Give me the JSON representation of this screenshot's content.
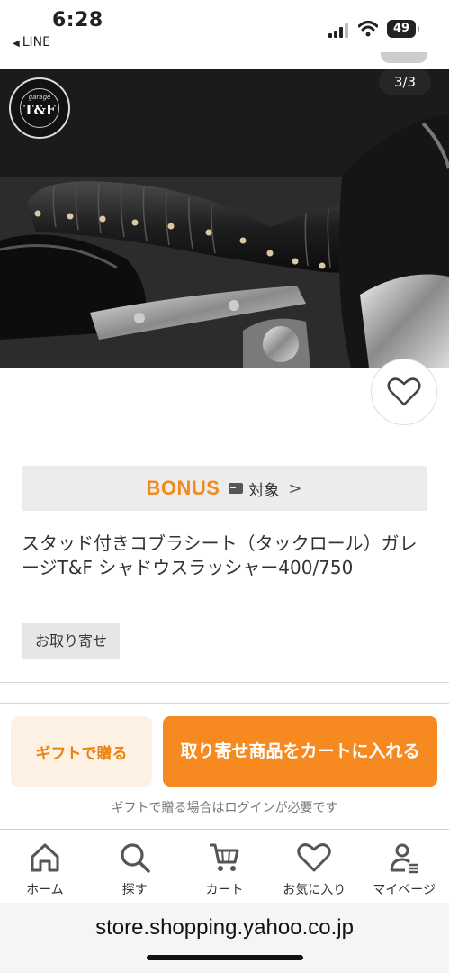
{
  "status": {
    "time": "6:28",
    "back_app": "LINE",
    "battery": "49"
  },
  "gallery": {
    "counter": "3/3",
    "logo_text": "T&F",
    "logo_small": "garage"
  },
  "bonus": {
    "logo": "BONUS",
    "text": "対象",
    "chevron": ">"
  },
  "product": {
    "title": "スタッド付きコブラシート（タックロール）ガレージT&F シャドウスラッシャー400/750",
    "tag": "お取り寄せ"
  },
  "actions": {
    "gift_label": "ギフトで贈る",
    "cart_label": "取り寄せ商品をカートに入れる",
    "note": "ギフトで贈る場合はログインが必要です"
  },
  "tabs": [
    {
      "label": "ホーム",
      "icon": "home-icon"
    },
    {
      "label": "探す",
      "icon": "search-icon"
    },
    {
      "label": "カート",
      "icon": "cart-icon"
    },
    {
      "label": "お気に入り",
      "icon": "heart-icon"
    },
    {
      "label": "マイページ",
      "icon": "user-icon"
    }
  ],
  "browser": {
    "url": "store.shopping.yahoo.co.jp"
  },
  "colors": {
    "accent": "#f6891f",
    "bonus": "#f08a1c",
    "gift_bg": "#fdf1e3"
  }
}
